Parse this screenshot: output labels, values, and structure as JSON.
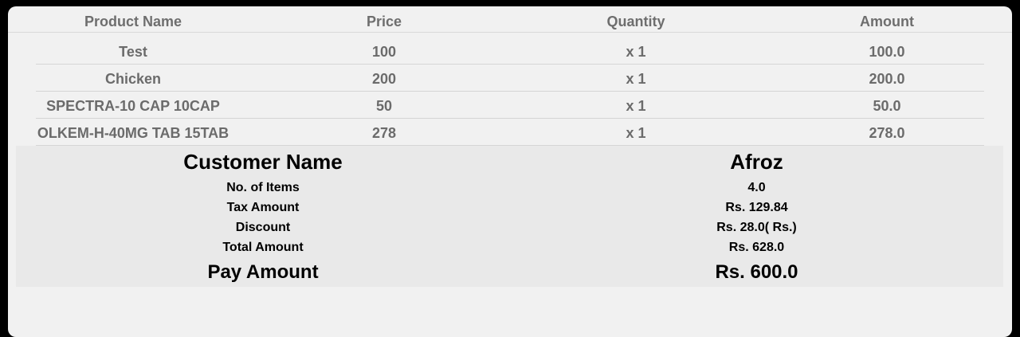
{
  "table": {
    "headers": {
      "product_name": "Product Name",
      "price": "Price",
      "quantity": "Quantity",
      "amount": "Amount"
    },
    "rows": [
      {
        "name": "Test",
        "price": "100",
        "qty": "x 1",
        "amount": "100.0"
      },
      {
        "name": "Chicken",
        "price": "200",
        "qty": "x 1",
        "amount": "200.0"
      },
      {
        "name": "SPECTRA-10 CAP  10CAP",
        "price": "50",
        "qty": "x 1",
        "amount": "50.0"
      },
      {
        "name": "OLKEM-H-40MG TAB  15TAB",
        "price": "278",
        "qty": "x 1",
        "amount": "278.0"
      }
    ]
  },
  "summary": {
    "customer_name_label": "Customer Name",
    "customer_name_value": "Afroz",
    "items_label": "No. of Items",
    "items_value": "4.0",
    "tax_label": "Tax Amount",
    "tax_value": "Rs. 129.84",
    "discount_label": "Discount",
    "discount_value": "Rs. 28.0( Rs.)",
    "total_label": "Total Amount",
    "total_value": "Rs. 628.0",
    "pay_label": "Pay Amount",
    "pay_value": "Rs. 600.0"
  }
}
